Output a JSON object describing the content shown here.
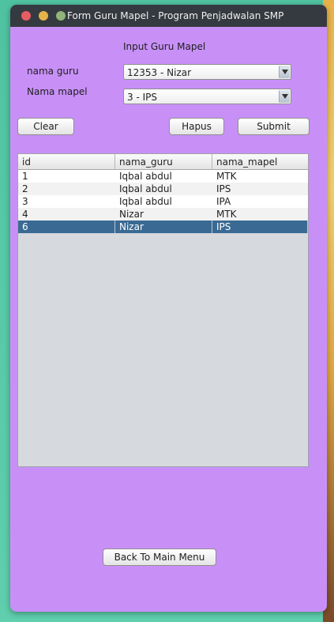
{
  "window": {
    "title": "Form Guru Mapel - Program Penjadwalan SMP"
  },
  "form": {
    "heading": "Input Guru Mapel",
    "guru_label": "nama guru",
    "guru_value": "12353 - Nizar",
    "mapel_label": "Nama mapel",
    "mapel_value": "3 - IPS"
  },
  "buttons": {
    "clear": "Clear",
    "hapus": "Hapus",
    "submit": "Submit",
    "back": "Back To Main Menu"
  },
  "table": {
    "columns": [
      "id",
      "nama_guru",
      "nama_mapel"
    ],
    "rows": [
      {
        "id": "1",
        "nama_guru": "Iqbal abdul",
        "nama_mapel": "MTK"
      },
      {
        "id": "2",
        "nama_guru": "Iqbal abdul",
        "nama_mapel": "IPS"
      },
      {
        "id": "3",
        "nama_guru": "Iqbal abdul",
        "nama_mapel": "IPA"
      },
      {
        "id": "4",
        "nama_guru": "Nizar",
        "nama_mapel": "MTK"
      },
      {
        "id": "6",
        "nama_guru": "Nizar",
        "nama_mapel": "IPS"
      }
    ],
    "selected_row_index": 4
  },
  "colors": {
    "window_bg": "#c890f7",
    "titlebar": "#353a40",
    "selection": "#3a6a93"
  }
}
